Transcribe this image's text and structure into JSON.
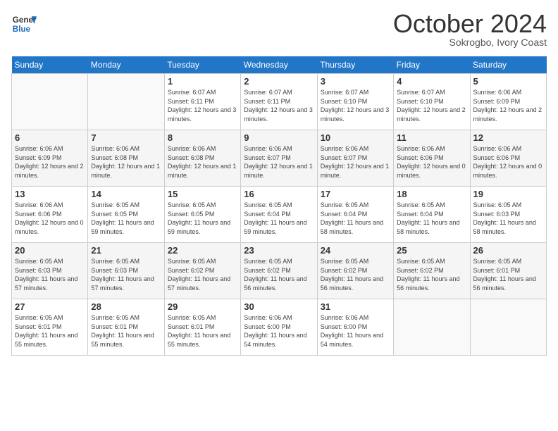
{
  "header": {
    "logo_general": "General",
    "logo_blue": "Blue",
    "month": "October 2024",
    "location": "Sokrogbo, Ivory Coast"
  },
  "weekdays": [
    "Sunday",
    "Monday",
    "Tuesday",
    "Wednesday",
    "Thursday",
    "Friday",
    "Saturday"
  ],
  "weeks": [
    [
      {
        "day": "",
        "detail": ""
      },
      {
        "day": "",
        "detail": ""
      },
      {
        "day": "1",
        "detail": "Sunrise: 6:07 AM\nSunset: 6:11 PM\nDaylight: 12 hours and 3 minutes."
      },
      {
        "day": "2",
        "detail": "Sunrise: 6:07 AM\nSunset: 6:11 PM\nDaylight: 12 hours and 3 minutes."
      },
      {
        "day": "3",
        "detail": "Sunrise: 6:07 AM\nSunset: 6:10 PM\nDaylight: 12 hours and 3 minutes."
      },
      {
        "day": "4",
        "detail": "Sunrise: 6:07 AM\nSunset: 6:10 PM\nDaylight: 12 hours and 2 minutes."
      },
      {
        "day": "5",
        "detail": "Sunrise: 6:06 AM\nSunset: 6:09 PM\nDaylight: 12 hours and 2 minutes."
      }
    ],
    [
      {
        "day": "6",
        "detail": "Sunrise: 6:06 AM\nSunset: 6:09 PM\nDaylight: 12 hours and 2 minutes."
      },
      {
        "day": "7",
        "detail": "Sunrise: 6:06 AM\nSunset: 6:08 PM\nDaylight: 12 hours and 1 minute."
      },
      {
        "day": "8",
        "detail": "Sunrise: 6:06 AM\nSunset: 6:08 PM\nDaylight: 12 hours and 1 minute."
      },
      {
        "day": "9",
        "detail": "Sunrise: 6:06 AM\nSunset: 6:07 PM\nDaylight: 12 hours and 1 minute."
      },
      {
        "day": "10",
        "detail": "Sunrise: 6:06 AM\nSunset: 6:07 PM\nDaylight: 12 hours and 1 minute."
      },
      {
        "day": "11",
        "detail": "Sunrise: 6:06 AM\nSunset: 6:06 PM\nDaylight: 12 hours and 0 minutes."
      },
      {
        "day": "12",
        "detail": "Sunrise: 6:06 AM\nSunset: 6:06 PM\nDaylight: 12 hours and 0 minutes."
      }
    ],
    [
      {
        "day": "13",
        "detail": "Sunrise: 6:06 AM\nSunset: 6:06 PM\nDaylight: 12 hours and 0 minutes."
      },
      {
        "day": "14",
        "detail": "Sunrise: 6:05 AM\nSunset: 6:05 PM\nDaylight: 11 hours and 59 minutes."
      },
      {
        "day": "15",
        "detail": "Sunrise: 6:05 AM\nSunset: 6:05 PM\nDaylight: 11 hours and 59 minutes."
      },
      {
        "day": "16",
        "detail": "Sunrise: 6:05 AM\nSunset: 6:04 PM\nDaylight: 11 hours and 59 minutes."
      },
      {
        "day": "17",
        "detail": "Sunrise: 6:05 AM\nSunset: 6:04 PM\nDaylight: 11 hours and 58 minutes."
      },
      {
        "day": "18",
        "detail": "Sunrise: 6:05 AM\nSunset: 6:04 PM\nDaylight: 11 hours and 58 minutes."
      },
      {
        "day": "19",
        "detail": "Sunrise: 6:05 AM\nSunset: 6:03 PM\nDaylight: 11 hours and 58 minutes."
      }
    ],
    [
      {
        "day": "20",
        "detail": "Sunrise: 6:05 AM\nSunset: 6:03 PM\nDaylight: 11 hours and 57 minutes."
      },
      {
        "day": "21",
        "detail": "Sunrise: 6:05 AM\nSunset: 6:03 PM\nDaylight: 11 hours and 57 minutes."
      },
      {
        "day": "22",
        "detail": "Sunrise: 6:05 AM\nSunset: 6:02 PM\nDaylight: 11 hours and 57 minutes."
      },
      {
        "day": "23",
        "detail": "Sunrise: 6:05 AM\nSunset: 6:02 PM\nDaylight: 11 hours and 56 minutes."
      },
      {
        "day": "24",
        "detail": "Sunrise: 6:05 AM\nSunset: 6:02 PM\nDaylight: 11 hours and 56 minutes."
      },
      {
        "day": "25",
        "detail": "Sunrise: 6:05 AM\nSunset: 6:02 PM\nDaylight: 11 hours and 56 minutes."
      },
      {
        "day": "26",
        "detail": "Sunrise: 6:05 AM\nSunset: 6:01 PM\nDaylight: 11 hours and 56 minutes."
      }
    ],
    [
      {
        "day": "27",
        "detail": "Sunrise: 6:05 AM\nSunset: 6:01 PM\nDaylight: 11 hours and 55 minutes."
      },
      {
        "day": "28",
        "detail": "Sunrise: 6:05 AM\nSunset: 6:01 PM\nDaylight: 11 hours and 55 minutes."
      },
      {
        "day": "29",
        "detail": "Sunrise: 6:05 AM\nSunset: 6:01 PM\nDaylight: 11 hours and 55 minutes."
      },
      {
        "day": "30",
        "detail": "Sunrise: 6:06 AM\nSunset: 6:00 PM\nDaylight: 11 hours and 54 minutes."
      },
      {
        "day": "31",
        "detail": "Sunrise: 6:06 AM\nSunset: 6:00 PM\nDaylight: 11 hours and 54 minutes."
      },
      {
        "day": "",
        "detail": ""
      },
      {
        "day": "",
        "detail": ""
      }
    ]
  ]
}
